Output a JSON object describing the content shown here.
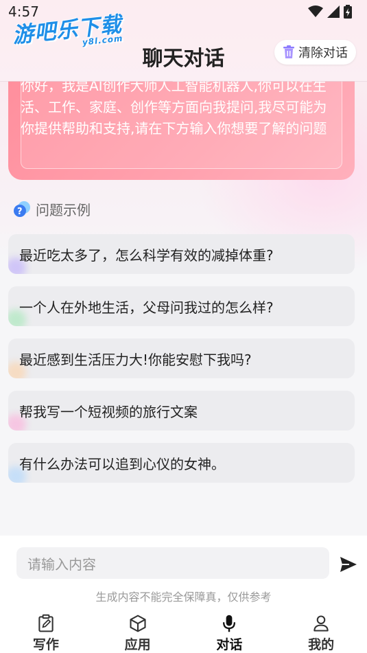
{
  "status": {
    "time": "4:57"
  },
  "watermark": {
    "text": "游吧乐下载",
    "sub": "y8l.com"
  },
  "header": {
    "title": "聊天对话",
    "clear_label": "清除对话"
  },
  "greeting": {
    "text": "你好，我是AI创作大师人工智能机器人,你可以在生活、工作、家庭、创作等方面向我提问,我尽可能为你提供帮助和支持,请在下方输入你想要了解的问题"
  },
  "examples": {
    "title": "问题示例",
    "items": [
      {
        "text": "最近吃太多了，怎么科学有效的减掉体重?",
        "accent": "#b9a6ff"
      },
      {
        "text": "一个人在外地生活，父母问我过的怎么样?",
        "accent": "#9be7b0"
      },
      {
        "text": "最近感到生活压力大!你能安慰下我吗?",
        "accent": "#ffcf9e"
      },
      {
        "text": "帮我写一个短视频的旅行文案",
        "accent": "#ffa8d8"
      },
      {
        "text": "有什么办法可以追到心仪的女神。",
        "accent": "#a8d4ff"
      }
    ]
  },
  "input": {
    "placeholder": "请输入内容"
  },
  "disclaimer": "生成内容不能完全保障真，仅供参考",
  "tabs": [
    {
      "label": "写作",
      "icon": "edit-icon"
    },
    {
      "label": "应用",
      "icon": "cube-icon"
    },
    {
      "label": "对话",
      "icon": "microphone-icon",
      "active": true
    },
    {
      "label": "我的",
      "icon": "user-icon"
    }
  ],
  "colors": {
    "accent": "#ff8e9c",
    "text": "#222222"
  }
}
